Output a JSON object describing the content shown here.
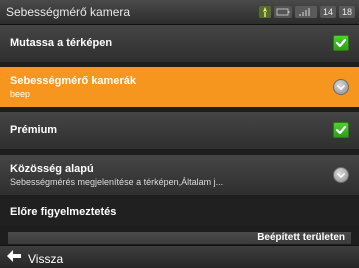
{
  "window": {
    "title": "Sebességmérő kamera"
  },
  "status": {
    "gps": "",
    "battery": "",
    "signal": "",
    "time_h": "14",
    "time_m": "18"
  },
  "rows": [
    {
      "label": "Mutassa a térképen",
      "control": "checkbox",
      "checked": true
    },
    {
      "label": "Sebességmérő kamerák",
      "value": "beep",
      "control": "chevron",
      "selected": true
    },
    {
      "label": "Prémium",
      "control": "checkbox",
      "checked": true
    },
    {
      "label": "Közösség alapú",
      "value": "Sebességmérés megjelenítése a térképen,Általam j...",
      "control": "chevron"
    }
  ],
  "section": {
    "label": "Előre figyelmeztetés"
  },
  "partial_item": {
    "label": "Beépített területen"
  },
  "footer": {
    "back_label": "Vissza"
  },
  "colors": {
    "accent": "#f6961e",
    "check": "#3bb826"
  }
}
